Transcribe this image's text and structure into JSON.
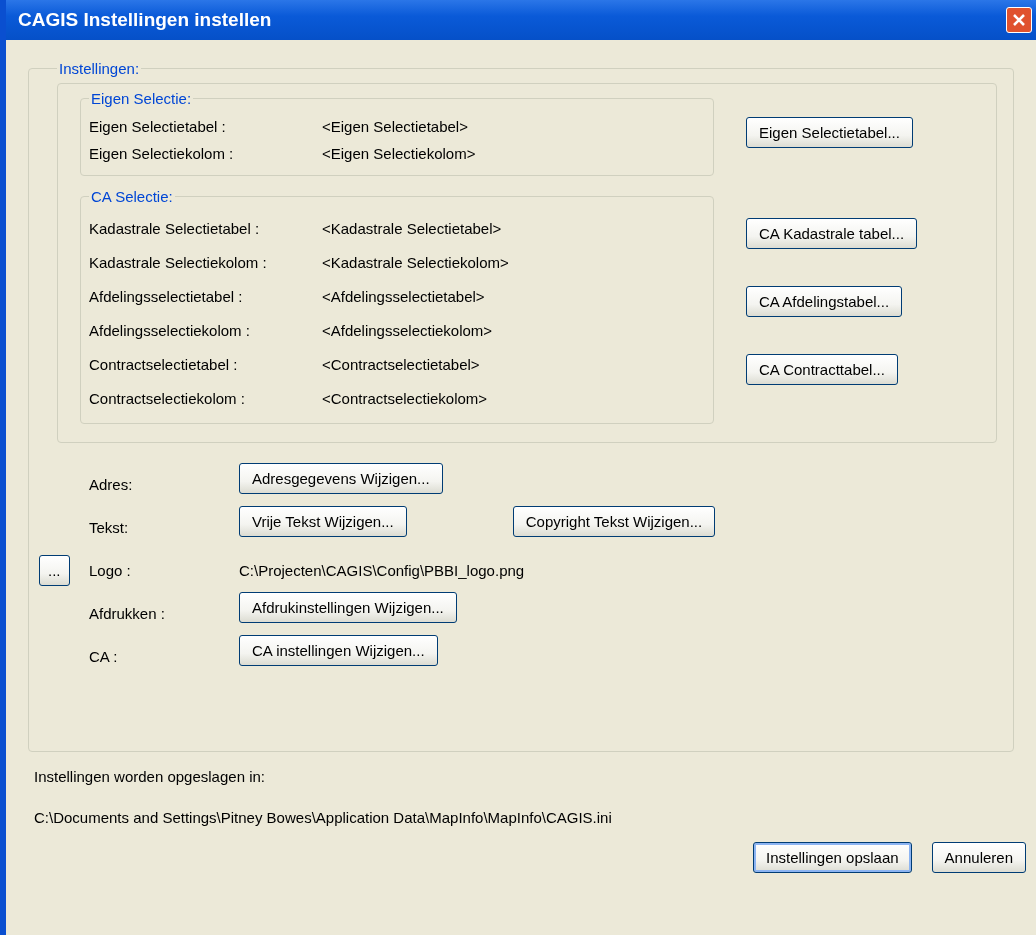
{
  "window": {
    "title": "CAGIS Instellingen instellen"
  },
  "settings": {
    "legend": "Instellingen:",
    "groups": [
      {
        "legend": "Eigen Selectie:",
        "rows": [
          {
            "label": "Eigen Selectietabel :",
            "value": "<Eigen Selectietabel>"
          },
          {
            "label": "Eigen Selectiekolom :",
            "value": "<Eigen Selectiekolom>"
          }
        ],
        "buttons": [
          "Eigen Selectietabel..."
        ]
      },
      {
        "legend": "CA Selectie:",
        "rows": [
          {
            "label": "Kadastrale Selectietabel :",
            "value": "<Kadastrale Selectietabel>"
          },
          {
            "label": "Kadastrale Selectiekolom :",
            "value": "<Kadastrale Selectiekolom>"
          },
          {
            "label": "Afdelingsselectietabel :",
            "value": "<Afdelingsselectietabel>"
          },
          {
            "label": "Afdelingsselectiekolom :",
            "value": "<Afdelingsselectiekolom>"
          },
          {
            "label": "Contractselectietabel :",
            "value": "<Contractselectietabel>"
          },
          {
            "label": "Contractselectiekolom :",
            "value": "<Contractselectiekolom>"
          }
        ],
        "buttons": [
          "CA Kadastrale tabel...",
          "CA Afdelingstabel...",
          "CA Contracttabel..."
        ]
      }
    ],
    "actions": [
      {
        "kind": "buttons",
        "label": "Adres:",
        "buttons": [
          "Adresgegevens Wijzigen..."
        ]
      },
      {
        "kind": "buttons",
        "label": "Tekst:",
        "buttons": [
          "Vrije Tekst Wijzigen...",
          "Copyright Tekst Wijzigen..."
        ]
      },
      {
        "kind": "path",
        "label": "Logo :",
        "browse": "...",
        "value": "C:\\Projecten\\CAGIS\\Config\\PBBI_logo.png"
      },
      {
        "kind": "buttons",
        "label": "Afdrukken :",
        "buttons": [
          "Afdrukinstellingen Wijzigen..."
        ]
      },
      {
        "kind": "buttons",
        "label": "CA :",
        "buttons": [
          "CA instellingen Wijzigen..."
        ]
      }
    ]
  },
  "save_location": {
    "caption": "Instellingen worden opgeslagen in:",
    "path": "C:\\Documents and Settings\\Pitney Bowes\\Application Data\\MapInfo\\MapInfo\\CAGIS.ini"
  },
  "footer_buttons": [
    {
      "label": "Instellingen opslaan",
      "focused": true
    },
    {
      "label": "Annuleren",
      "focused": false
    }
  ]
}
